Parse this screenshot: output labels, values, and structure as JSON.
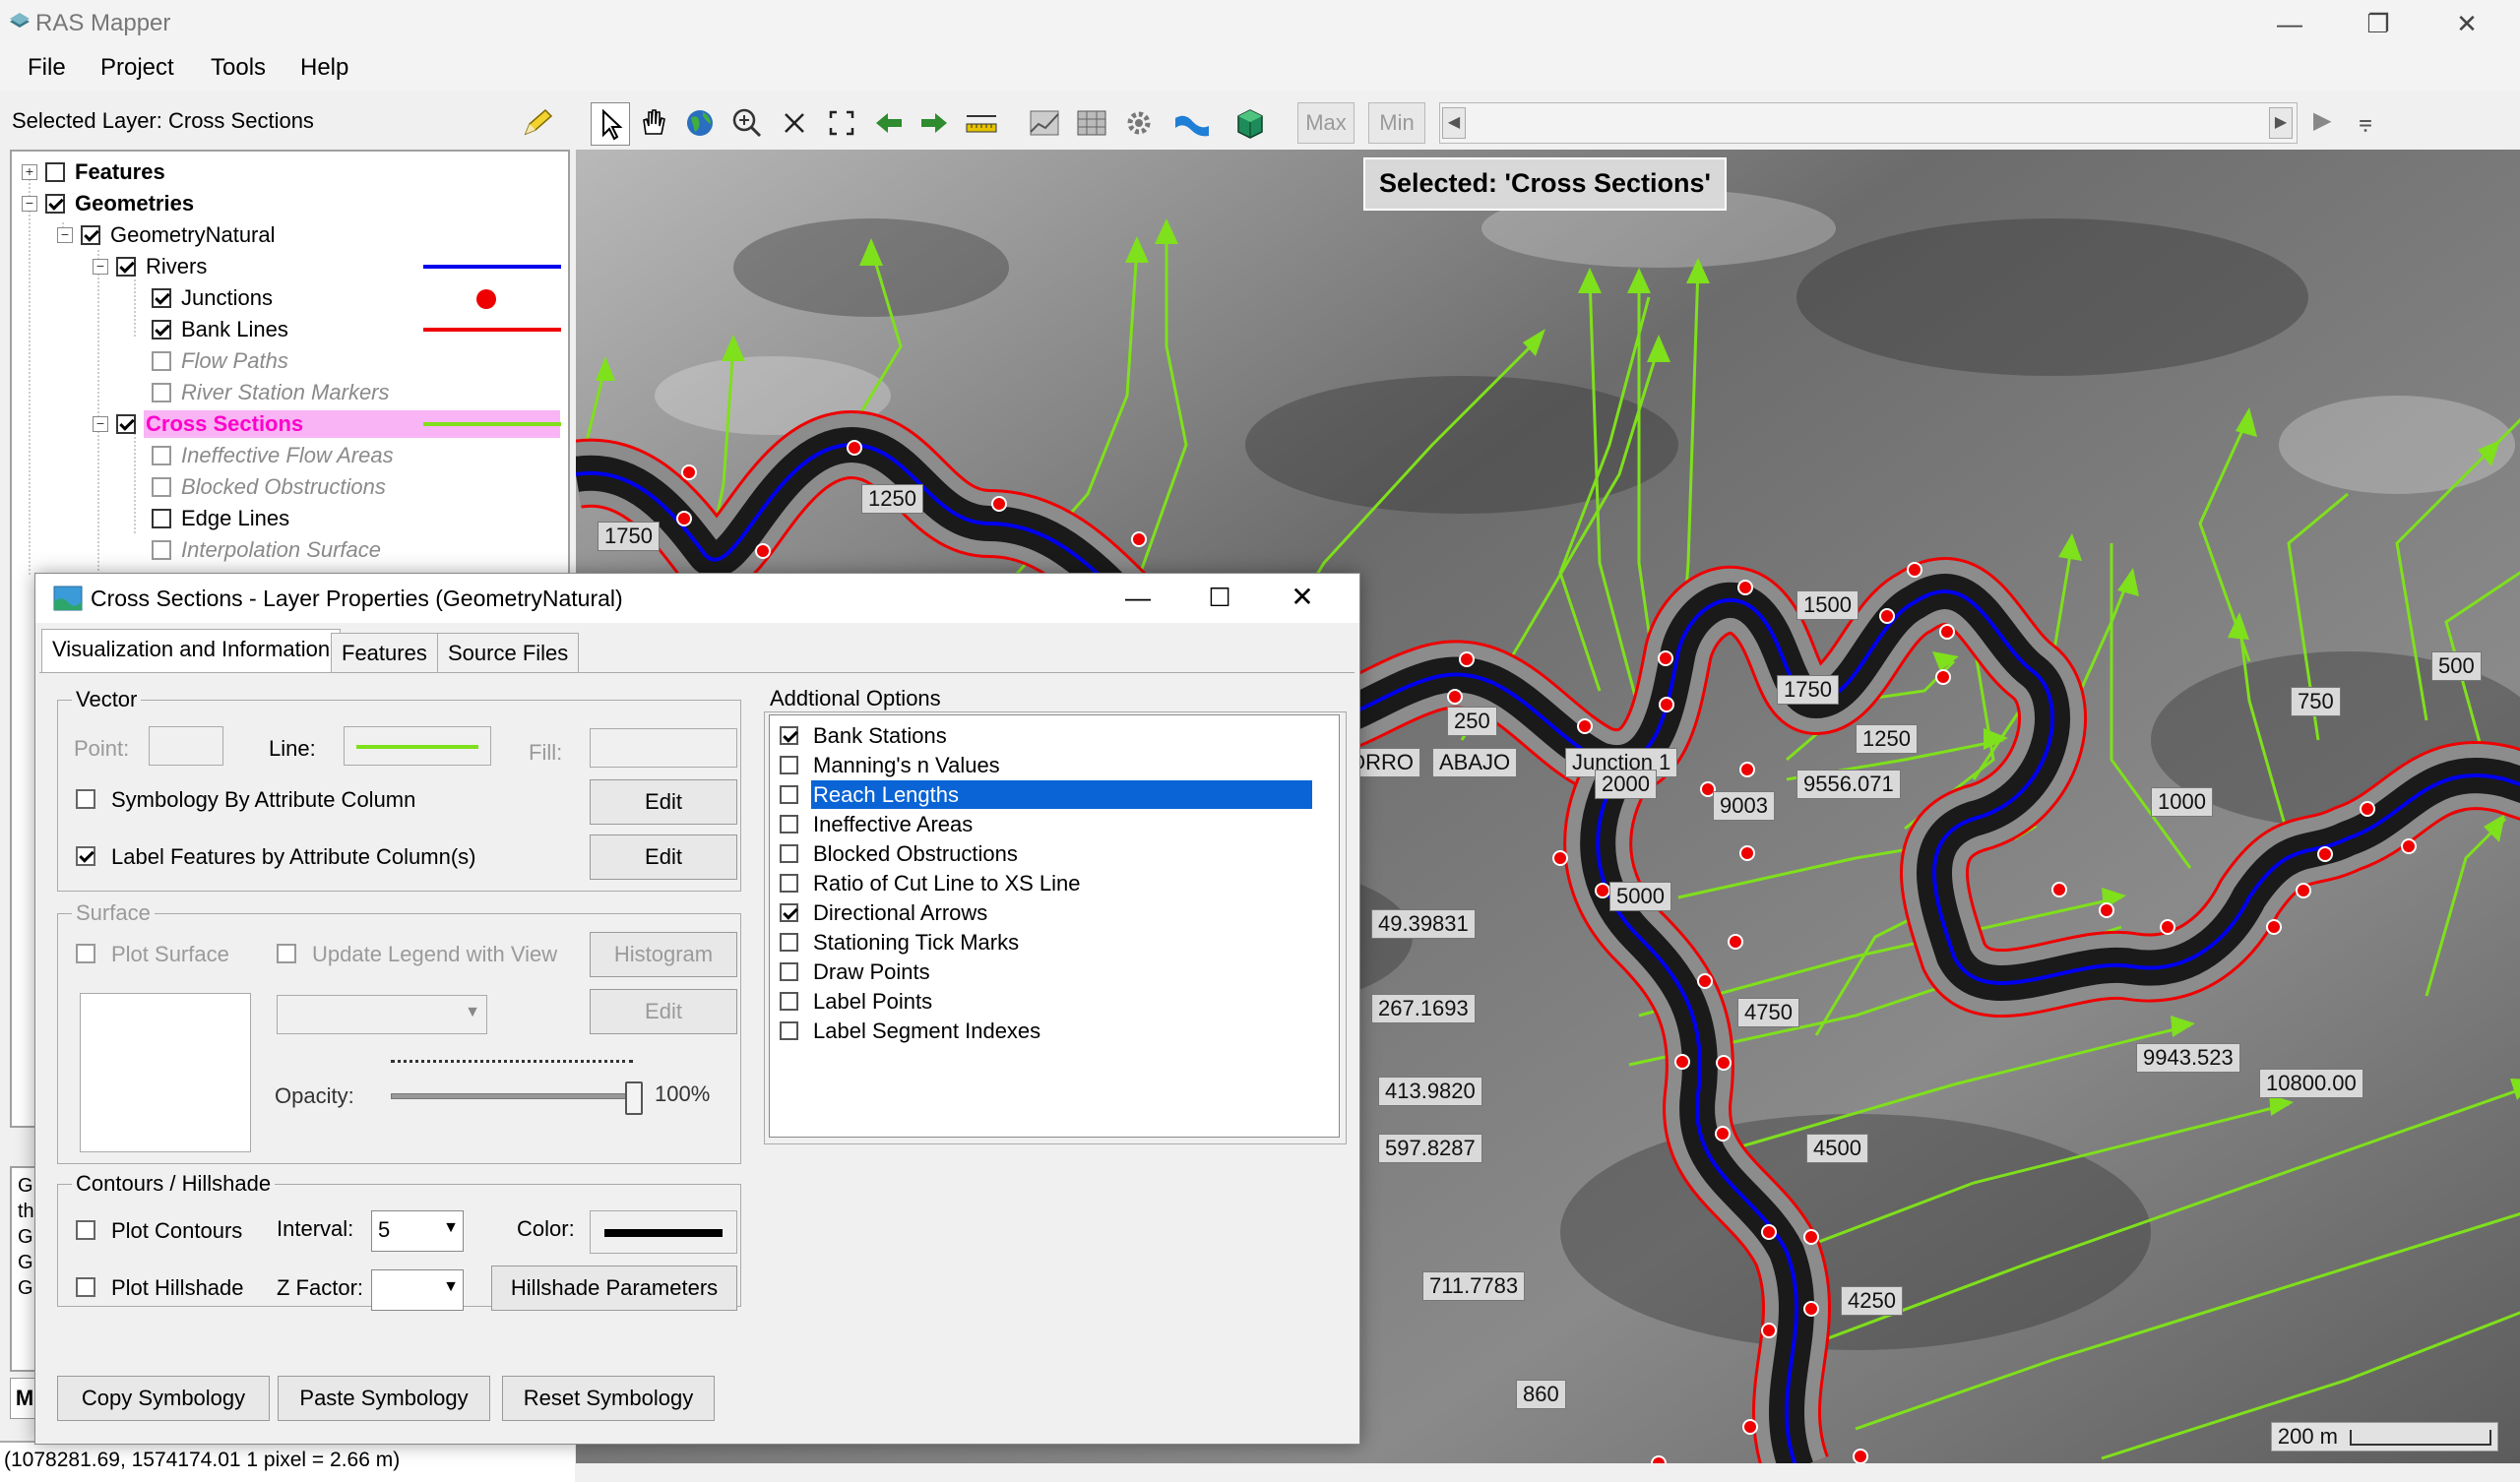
{
  "window": {
    "title": "RAS Mapper",
    "minimize": "—",
    "restore": "❐",
    "close": "✕"
  },
  "menu": [
    "File",
    "Project",
    "Tools",
    "Help"
  ],
  "toolbar": {
    "selected_layer": "Selected Layer: Cross Sections",
    "max": "Max",
    "min": "Min"
  },
  "tree": [
    {
      "label": "Features",
      "bold": true,
      "checked": false,
      "indent": 0,
      "expander": "+"
    },
    {
      "label": "Geometries",
      "bold": true,
      "checked": true,
      "indent": 0,
      "expander": "−"
    },
    {
      "label": "GeometryNatural",
      "checked": true,
      "indent": 1,
      "expander": "−"
    },
    {
      "label": "Rivers",
      "checked": true,
      "indent": 2,
      "expander": "−",
      "legend": "blue-line"
    },
    {
      "label": "Junctions",
      "checked": true,
      "indent": 3,
      "legend": "red-dot"
    },
    {
      "label": "Bank Lines",
      "checked": true,
      "indent": 3,
      "legend": "red-line"
    },
    {
      "label": "Flow Paths",
      "checked": false,
      "indent": 3,
      "italic": true
    },
    {
      "label": "River Station Markers",
      "checked": false,
      "indent": 3,
      "italic": true
    },
    {
      "label": "Cross Sections",
      "checked": true,
      "indent": 2,
      "expander": "−",
      "legend": "green-line",
      "selected": true
    },
    {
      "label": "Ineffective Flow Areas",
      "checked": false,
      "indent": 3,
      "italic": true
    },
    {
      "label": "Blocked Obstructions",
      "checked": false,
      "indent": 3,
      "italic": true
    },
    {
      "label": "Edge Lines",
      "checked": false,
      "indent": 3
    },
    {
      "label": "Interpolation Surface",
      "checked": false,
      "indent": 3,
      "italic": true
    }
  ],
  "legend_colors": {
    "blue-line": "#0000ee",
    "red-dot": "#ee0000",
    "red-line": "#ee0000",
    "green-line": "#7fe01c"
  },
  "status": "(1078281.69, 1574174.01  1 pixel = 2.66 m)",
  "log_letters": [
    "G",
    "th",
    "G",
    "G",
    "G"
  ],
  "map": {
    "selected_label": "Selected: 'Cross Sections'",
    "labels": [
      "1750",
      "1250",
      "250",
      "1750",
      "1500",
      "1250",
      "750",
      "500",
      "1000",
      "ORRO",
      "ABAJO",
      "Junction 1",
      "2000",
      "9003",
      "9556.071",
      "5000",
      "49.39831",
      "267.1693",
      "413.9820",
      "597.8287",
      "711.7783",
      "860",
      "4750",
      "4500",
      "4250",
      "9943.523",
      "10800.00"
    ],
    "scale": "200 m"
  },
  "dialog": {
    "title": "Cross Sections - Layer Properties (GeometryNatural)",
    "tabs": [
      "Visualization and Information",
      "Features",
      "Source Files"
    ],
    "vector": {
      "title": "Vector",
      "point": "Point:",
      "line": "Line:",
      "fill": "Fill:",
      "symbology": "Symbology By Attribute Column",
      "label_features": "Label Features by Attribute Column(s)",
      "edit": "Edit",
      "symbology_checked": false,
      "label_checked": true
    },
    "surface": {
      "title": "Surface",
      "plot_surface": "Plot Surface",
      "update_legend": "Update Legend with View",
      "histogram": "Histogram",
      "edit": "Edit",
      "opacity": "Opacity:",
      "opacity_value": "100%",
      "opacity_fraction": 1.0
    },
    "contours": {
      "title": "Contours / Hillshade",
      "plot_contours": "Plot Contours",
      "interval": "Interval:",
      "interval_value": "5",
      "color": "Color:",
      "plot_hillshade": "Plot Hillshade",
      "z_factor": "Z Factor:",
      "hillshade_params": "Hillshade Parameters"
    },
    "options": {
      "title": "Addtional Options",
      "items": [
        {
          "label": "Bank Stations",
          "checked": true
        },
        {
          "label": "Manning's n Values",
          "checked": false
        },
        {
          "label": "Reach Lengths",
          "checked": false,
          "selected": true
        },
        {
          "label": "Ineffective Areas",
          "checked": false
        },
        {
          "label": "Blocked Obstructions",
          "checked": false
        },
        {
          "label": "Ratio of Cut Line to XS Line",
          "checked": false
        },
        {
          "label": "Directional Arrows",
          "checked": true
        },
        {
          "label": "Stationing Tick Marks",
          "checked": false
        },
        {
          "label": "Draw Points",
          "checked": false
        },
        {
          "label": "Label Points",
          "checked": false
        },
        {
          "label": "Label Segment Indexes",
          "checked": false
        }
      ]
    },
    "buttons": {
      "copy": "Copy Symbology",
      "paste": "Paste Symbology",
      "reset": "Reset Symbology"
    }
  }
}
